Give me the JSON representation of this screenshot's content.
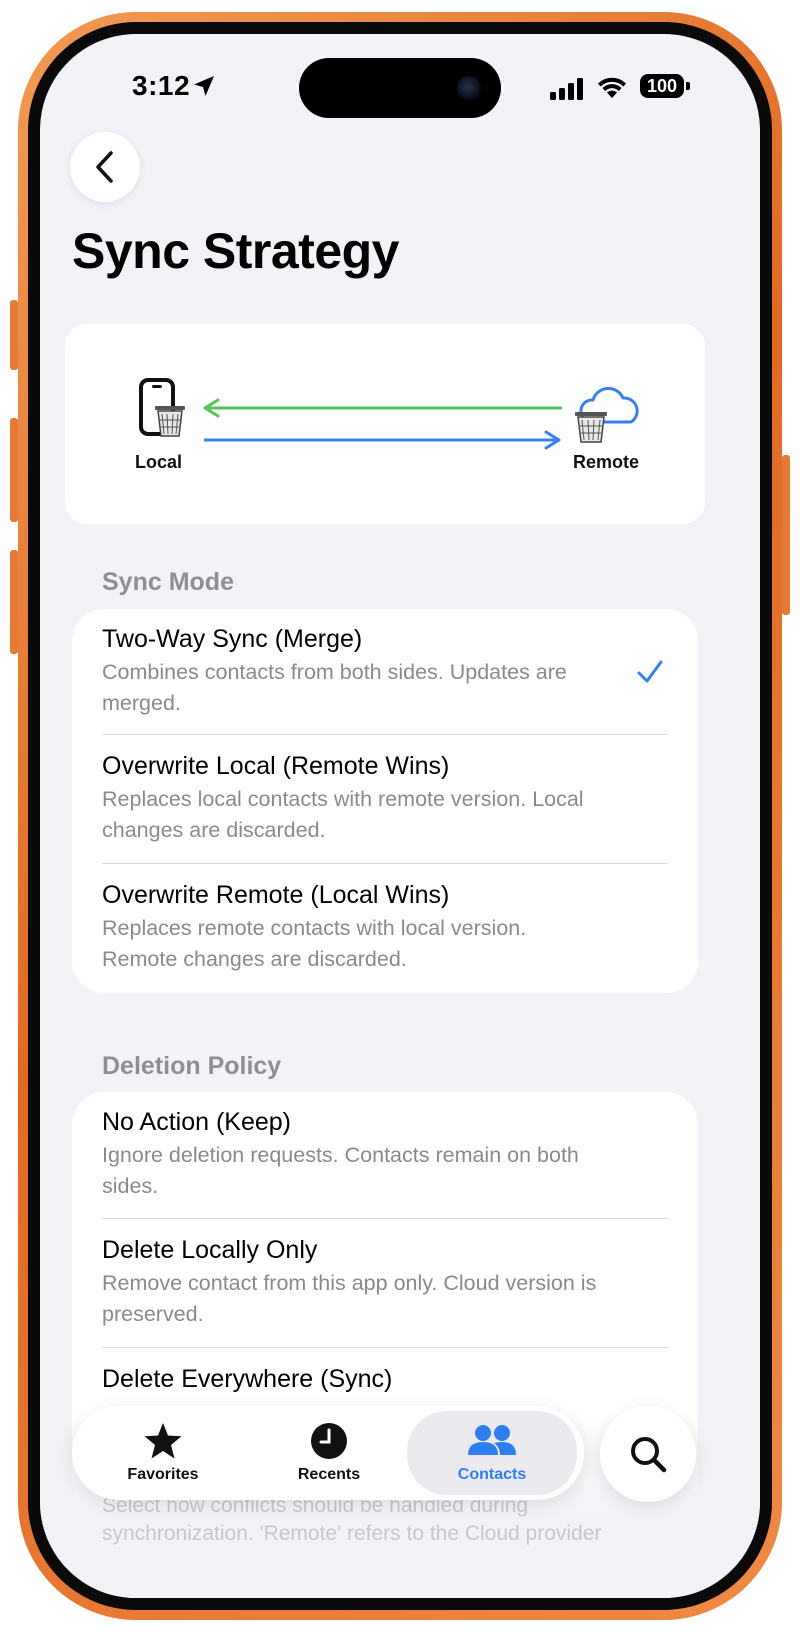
{
  "status_bar": {
    "time": "3:12",
    "battery": "100"
  },
  "page": {
    "title": "Sync Strategy"
  },
  "diagram": {
    "local_label": "Local",
    "remote_label": "Remote",
    "colors": {
      "to_local": "#5ac05a",
      "to_remote": "#3a7fe8"
    }
  },
  "sync_mode": {
    "header": "Sync Mode",
    "options": [
      {
        "title": "Two-Way Sync (Merge)",
        "description": "Combines contacts from both sides. Updates are merged.",
        "selected": true
      },
      {
        "title": "Overwrite Local (Remote Wins)",
        "description": "Replaces local contacts with remote version. Local changes are discarded.",
        "selected": false
      },
      {
        "title": "Overwrite Remote (Local Wins)",
        "description": "Replaces remote contacts with local version. Remote changes are discarded.",
        "selected": false
      }
    ]
  },
  "deletion_policy": {
    "header": "Deletion Policy",
    "options": [
      {
        "title": "No Action (Keep)",
        "description": "Ignore deletion requests. Contacts remain on both sides."
      },
      {
        "title": "Delete Locally Only",
        "description": "Remove contact from this app only. Cloud version is preserved."
      },
      {
        "title": "Delete Everywhere (Sync)",
        "description": ""
      }
    ]
  },
  "footer_note": "Select how conflicts should be handled during synchronization. 'Remote' refers to the Cloud provider",
  "tab_bar": {
    "tabs": [
      {
        "label": "Favorites",
        "icon": "star-icon",
        "active": false
      },
      {
        "label": "Recents",
        "icon": "clock-icon",
        "active": false
      },
      {
        "label": "Contacts",
        "icon": "contacts-icon",
        "active": true
      }
    ],
    "search_icon": "search-icon",
    "accent": "#2f7ef0"
  }
}
